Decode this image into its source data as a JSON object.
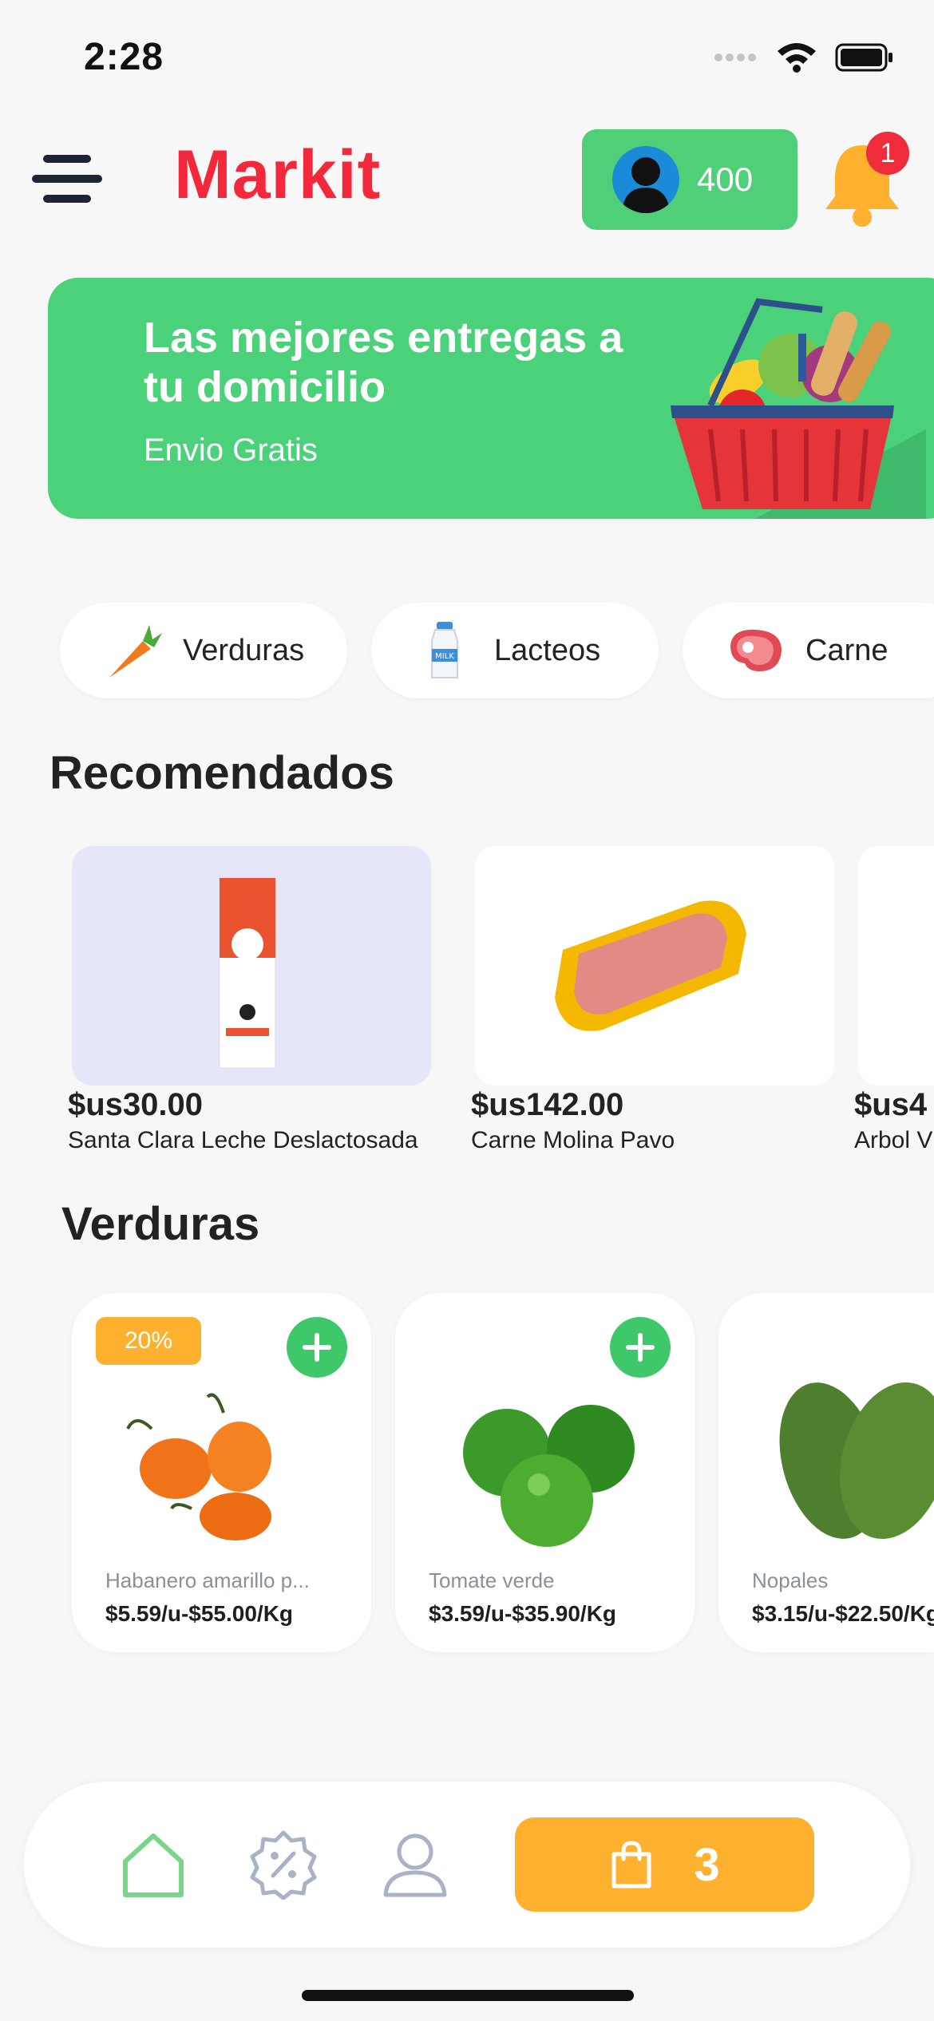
{
  "status_bar": {
    "time": "2:28"
  },
  "header": {
    "logo": "Markit",
    "points": "400",
    "notifications": "1"
  },
  "banner": {
    "title": "Las mejores entregas a tu domicilio",
    "subtitle": "Envio Gratis"
  },
  "categories": [
    {
      "label": "Verduras",
      "icon": "carrot-icon"
    },
    {
      "label": "Lacteos",
      "icon": "milk-icon"
    },
    {
      "label": "Carne",
      "icon": "steak-icon"
    }
  ],
  "recommended": {
    "title": "Recomendados",
    "items": [
      {
        "price": "$us30.00",
        "name": "Santa Clara Leche Deslactosada"
      },
      {
        "price": "$us142.00",
        "name": "Carne Molina Pavo"
      },
      {
        "price": "$us4",
        "name": "Arbol V"
      }
    ]
  },
  "vegetables": {
    "title": "Verduras",
    "items": [
      {
        "discount": "20%",
        "name": "Habanero amarillo p...",
        "price": "$5.59/u-$55.00/Kg"
      },
      {
        "name": "Tomate verde",
        "price": "$3.59/u-$35.90/Kg"
      },
      {
        "name": "Nopales",
        "price": "$3.15/u-$22.50/Kg"
      }
    ]
  },
  "bottom_nav": {
    "cart_count": "3"
  },
  "colors": {
    "brand_red": "#f3283b",
    "green": "#4bd17a",
    "orange": "#fdb12e"
  }
}
